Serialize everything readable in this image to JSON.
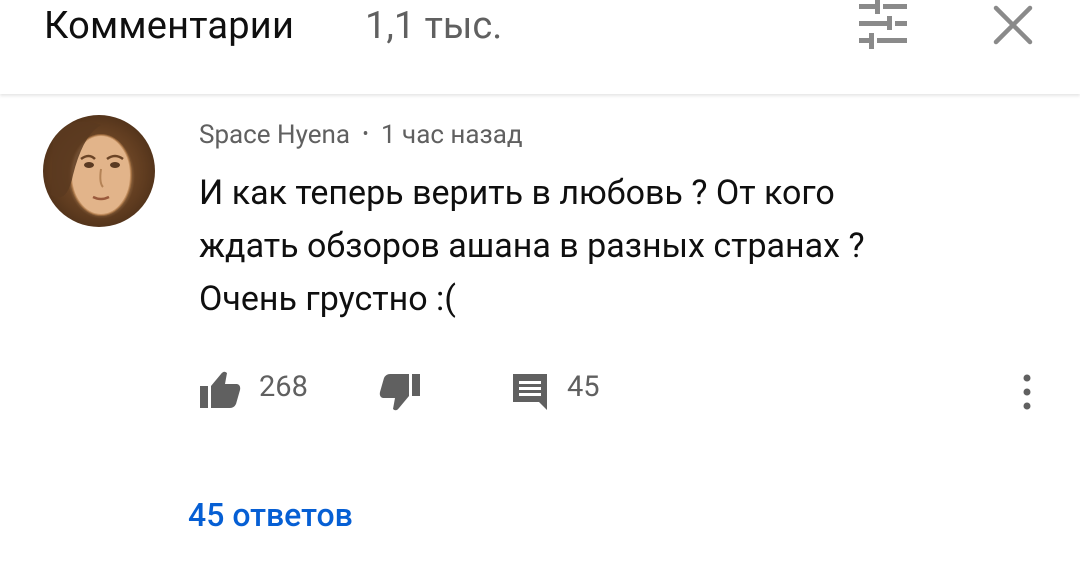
{
  "header": {
    "title": "Комментарии",
    "count": "1,1 тыс."
  },
  "comment": {
    "author": "Space Hyena",
    "separator": "•",
    "time": "1 час назад",
    "lines": [
      "И как теперь верить в любовь ? От кого",
      "ждать обзоров ашана в разных странах ?",
      "Очень грустно :("
    ],
    "likes": "268",
    "replies_count": "45",
    "view_replies": "45 ответов"
  },
  "icons": {
    "filter": "filter-sliders-icon",
    "close": "close-icon",
    "like": "thumbs-up-icon",
    "dislike": "thumbs-down-icon",
    "reply": "comment-bubble-icon",
    "more": "more-vert-icon"
  },
  "colors": {
    "primary_text": "#0f0f0f",
    "secondary_text": "#606060",
    "link": "#065fd4"
  }
}
